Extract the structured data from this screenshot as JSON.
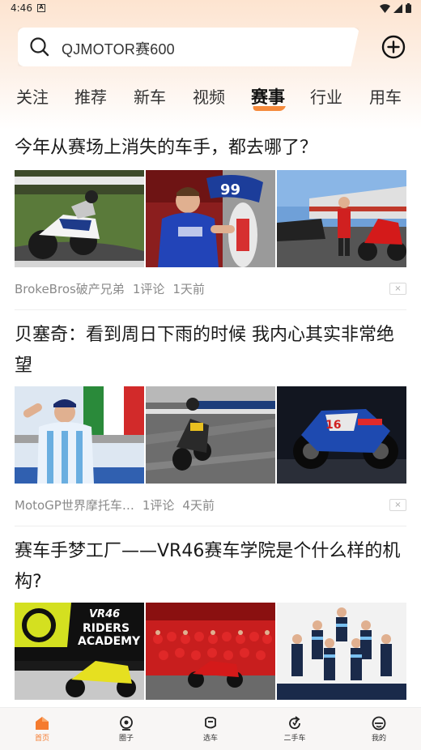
{
  "status_bar": {
    "time": "4:46",
    "notification": "A"
  },
  "search": {
    "query": "QJMOTOR赛600"
  },
  "tabs": [
    {
      "label": "关注"
    },
    {
      "label": "推荐"
    },
    {
      "label": "新车"
    },
    {
      "label": "视频"
    },
    {
      "label": "赛事",
      "active": true
    },
    {
      "label": "行业"
    },
    {
      "label": "用车"
    }
  ],
  "articles": [
    {
      "title": "今年从赛场上消失的车手，都去哪了？",
      "author": "BrokeBros破产兄弟",
      "comments": "1评论",
      "time": "1天前"
    },
    {
      "title": "贝塞奇：看到周日下雨的时候 我内心其实非常绝望",
      "author": "MotoGP世界摩托车…",
      "comments": "1评论",
      "time": "4天前"
    },
    {
      "title": "赛车手梦工厂——VR46赛车学院是个什么样的机构?",
      "image_text": {
        "vr46": "VR46",
        "riders": "RIDERS",
        "academy": "ACADEMY"
      }
    }
  ],
  "close_glyph": "×",
  "bottom_nav": [
    {
      "label": "首页",
      "icon": "home-icon",
      "active": true
    },
    {
      "label": "圈子",
      "icon": "circle-icon"
    },
    {
      "label": "选车",
      "icon": "helmet-icon"
    },
    {
      "label": "二手车",
      "icon": "refresh-icon"
    },
    {
      "label": "我的",
      "icon": "profile-icon"
    }
  ],
  "colors": {
    "accent": "#f57b2e",
    "tab_underline": "#f58a3c"
  }
}
